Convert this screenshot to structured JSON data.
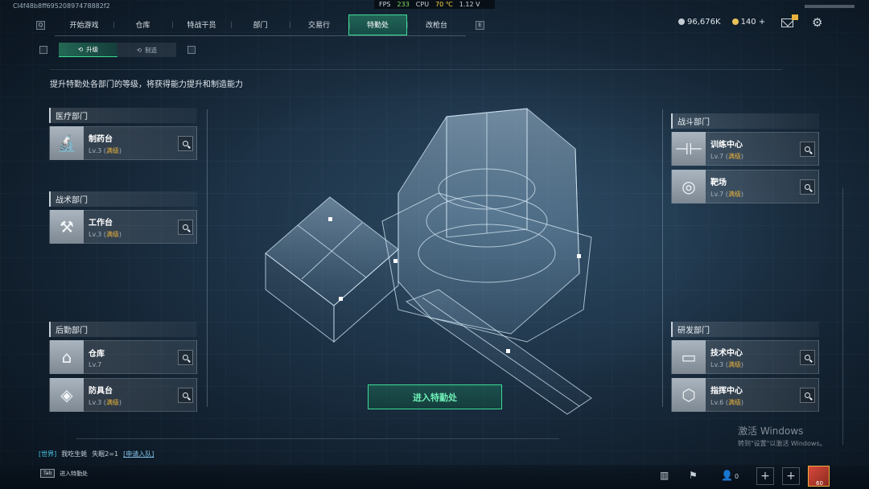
{
  "perf": {
    "fps_label": "FPS",
    "fps": "233",
    "cpu_label": "CPU",
    "cpu": "70 ℃",
    "version": "1.12 V"
  },
  "uid": "Cl4f48b8ff69520897478882f2",
  "nav": {
    "prev_key": "Q",
    "next_key": "E",
    "tabs": [
      "开始游戏",
      "仓库",
      "特战干员",
      "部门",
      "交易行",
      "特勤处",
      "改枪台"
    ],
    "active_index": 5
  },
  "currency": {
    "silver": "96,676K",
    "gold": "140 +"
  },
  "subnav": {
    "prev_key": "A",
    "next_key": "D",
    "tabs": [
      "升级",
      "制造"
    ],
    "active_index": 0
  },
  "description": "提升特勤处各部门的等级，将获得能力提升和制造能力",
  "departments": {
    "medical": {
      "title": "医疗部门",
      "items": [
        {
          "name": "制药台",
          "level": "Lv.3",
          "status": "满级",
          "icon": "microscope-icon"
        }
      ]
    },
    "tactical": {
      "title": "战术部门",
      "items": [
        {
          "name": "工作台",
          "level": "Lv.3",
          "status": "满级",
          "icon": "tools-icon"
        }
      ]
    },
    "logistics": {
      "title": "后勤部门",
      "items": [
        {
          "name": "仓库",
          "level": "Lv.7",
          "status": "",
          "icon": "warehouse-icon"
        },
        {
          "name": "防具台",
          "level": "Lv.3",
          "status": "满级",
          "icon": "armor-icon"
        }
      ]
    },
    "combat": {
      "title": "战斗部门",
      "items": [
        {
          "name": "训练中心",
          "level": "Lv.7",
          "status": "满级",
          "icon": "dumbbell-icon"
        },
        {
          "name": "靶场",
          "level": "Lv.7",
          "status": "满级",
          "icon": "target-icon"
        }
      ]
    },
    "research": {
      "title": "研发部门",
      "items": [
        {
          "name": "技术中心",
          "level": "Lv.3",
          "status": "满级",
          "icon": "monitor-icon"
        },
        {
          "name": "指挥中心",
          "level": "Lv.6",
          "status": "满级",
          "icon": "chip-icon"
        }
      ]
    }
  },
  "enter_button": "进入特勤处",
  "watermark": {
    "line1": "激活 Windows",
    "line2": "转到\"设置\"以激活 Windows。"
  },
  "chat": {
    "channel": "[世界]",
    "user": "我吃生蚝",
    "message": "失眠2=1",
    "apply": "[申请入队]"
  },
  "bottom": {
    "tab_key": "Tab",
    "tab_label": "进入特勤处",
    "friends_count": "0",
    "avatar_level": "60"
  },
  "colors": {
    "accent": "#3ddc97",
    "max_level": "#e8b23a"
  }
}
